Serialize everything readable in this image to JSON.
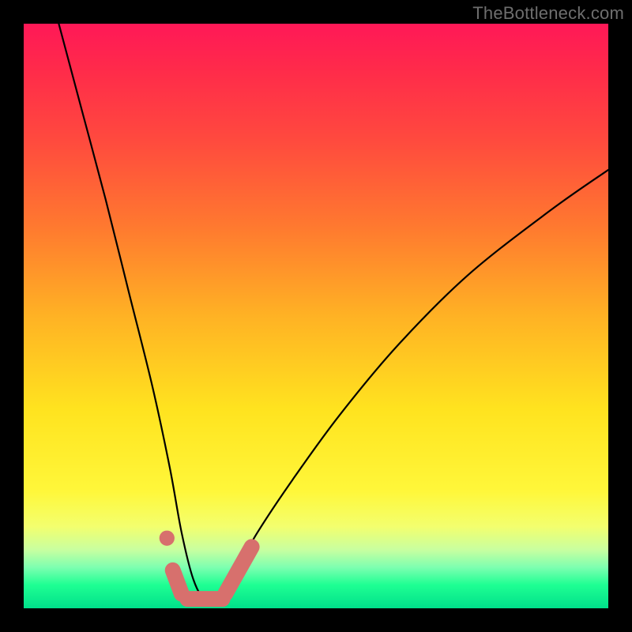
{
  "watermark": {
    "text": "TheBottleneck.com"
  },
  "colors": {
    "frame": "#000000",
    "curve_stroke": "#000000",
    "marker_stroke": "#d7706d",
    "marker_fill": "#d7706d"
  },
  "chart_data": {
    "type": "line",
    "title": "",
    "xlabel": "",
    "ylabel": "",
    "xlim": [
      0,
      100
    ],
    "ylim": [
      0,
      100
    ],
    "grid": false,
    "legend": false,
    "note": "No axis ticks or numeric labels are visible; values are estimated positions in a 0–100 plot-area coordinate system (x right, y up). The black curve is a V-shaped bottleneck well with its minimum near x≈31 at the bottom edge. Pink markers sit at the bottom of the well.",
    "series": [
      {
        "name": "bottleneck-curve",
        "x": [
          6,
          10,
          14,
          18,
          22,
          25,
          27,
          29,
          31,
          33,
          36,
          40,
          46,
          54,
          64,
          76,
          90,
          100
        ],
        "y": [
          100,
          85,
          70,
          54,
          38,
          24,
          13,
          5,
          1.5,
          2.5,
          6,
          13,
          22,
          33,
          45,
          57,
          68,
          75
        ]
      }
    ],
    "markers": [
      {
        "name": "left-dot",
        "shape": "circle",
        "x": 24.5,
        "y": 12,
        "r": 1.3
      },
      {
        "name": "left-pill",
        "shape": "pill",
        "x0": 25.5,
        "y0": 6.5,
        "x1": 27.0,
        "y1": 2.5,
        "t": 2.7
      },
      {
        "name": "well-seg",
        "shape": "pill",
        "x0": 28.0,
        "y0": 1.6,
        "x1": 34.0,
        "y1": 1.6,
        "t": 2.7
      },
      {
        "name": "right-pill",
        "shape": "pill",
        "x0": 34.5,
        "y0": 2.5,
        "x1": 39.0,
        "y1": 10.5,
        "t": 2.7
      }
    ]
  }
}
